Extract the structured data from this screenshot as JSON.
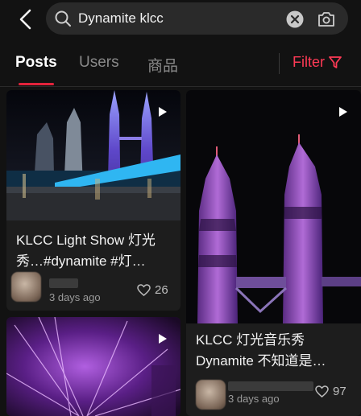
{
  "search": {
    "query": "Dynamite klcc",
    "icons": {
      "back": "chevron-left-icon",
      "search": "search-icon",
      "clear": "clear-circle-icon",
      "camera": "camera-search-icon"
    }
  },
  "tabs": [
    {
      "label": "Posts",
      "active": true
    },
    {
      "label": "Users",
      "active": false
    },
    {
      "label": "商品",
      "active": false
    }
  ],
  "filter": {
    "label": "Filter",
    "icon": "funnel-icon",
    "color": "#ff3a56"
  },
  "posts": [
    {
      "title": "KLCC Light Show 灯光秀…#dynamite #灯…",
      "date": "3 days ago",
      "likes": "26",
      "video": true
    },
    {
      "title": "KLCC 灯光音乐秀 Dynamite 不知道是…",
      "date": "3 days ago",
      "likes": "97",
      "video": true
    },
    {
      "video": true
    }
  ],
  "colors": {
    "accent": "#e2233b",
    "background": "#121212",
    "card": "#1d1d1d"
  }
}
